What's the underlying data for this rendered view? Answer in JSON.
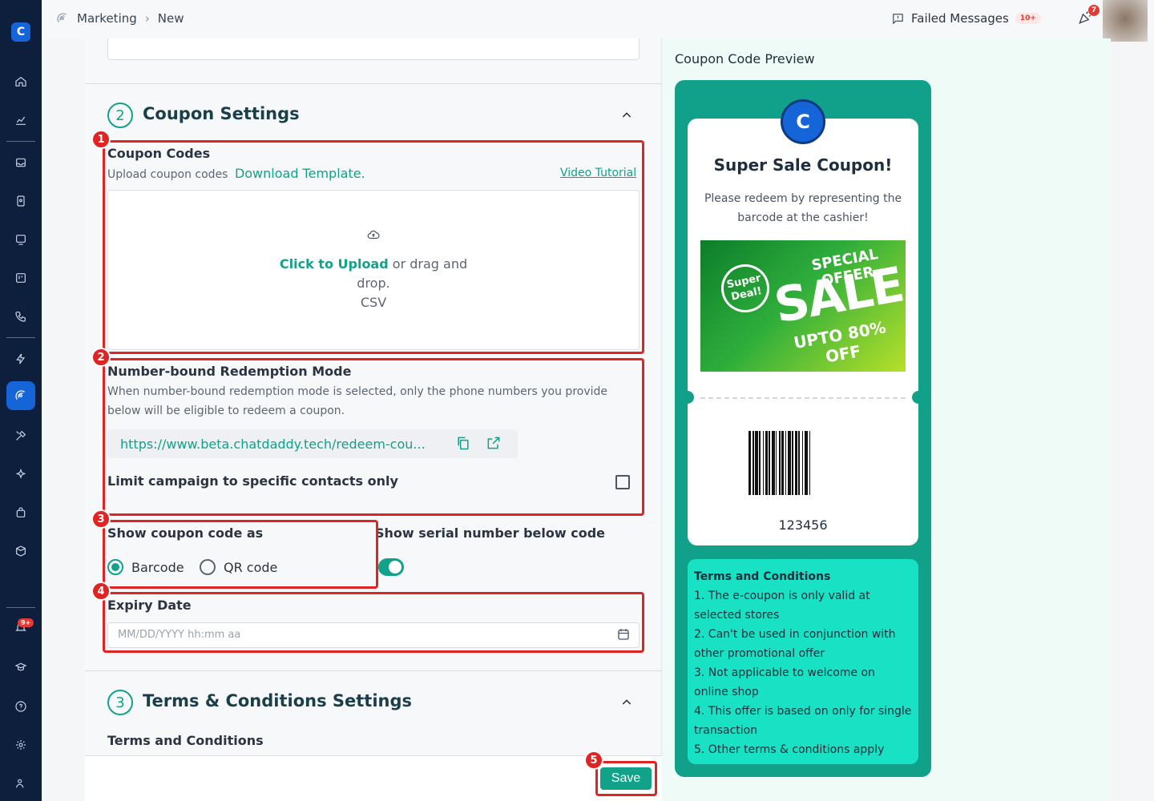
{
  "breadcrumb": {
    "section": "Marketing",
    "current": "New"
  },
  "topbar": {
    "failed_label": "Failed Messages",
    "failed_count": "10+",
    "notif_count": "7"
  },
  "sidebar": {
    "alerts_badge": "9+"
  },
  "coupon_settings": {
    "number": "2",
    "title": "Coupon Settings",
    "codes_label": "Coupon Codes",
    "codes_sub": "Upload coupon codes",
    "download_template": "Download Template.",
    "video_tutorial": "Video Tutorial",
    "upload_cta": "Click to Upload",
    "upload_rest": " or drag and",
    "upload_rest2": "drop.",
    "upload_format": "CSV",
    "redemption_label": "Number-bound Redemption Mode",
    "redemption_desc1": "When number-bound redemption mode is selected, only the phone numbers you provide",
    "redemption_desc2": "below will be eligible to redeem a coupon.",
    "redeem_url": "https://www.beta.chatdaddy.tech/redeem-cou...",
    "limit_label": "Limit campaign to specific contacts only",
    "show_as_label": "Show coupon code as",
    "option_barcode": "Barcode",
    "option_qr": "QR code",
    "serial_label": "Show serial number below code",
    "expiry_label": "Expiry Date",
    "expiry_placeholder": "MM/DD/YYYY hh:mm aa"
  },
  "terms_settings": {
    "number": "3",
    "title": "Terms & Conditions Settings",
    "sub_label": "Terms and Conditions"
  },
  "footer": {
    "save": "Save"
  },
  "annotations": {
    "n1": "1",
    "n2": "2",
    "n3": "3",
    "n4": "4",
    "n5": "5"
  },
  "preview": {
    "heading": "Coupon Code Preview",
    "title": "Super Sale Coupon!",
    "desc": "Please redeem by representing the barcode at the cashier!",
    "banner_special": "SPECIAL OFFER",
    "banner_sale": "SALE",
    "banner_upto": "UPTO 80% OFF",
    "banner_deal1": "Super",
    "banner_deal2": "Deal!",
    "code": "123456",
    "terms_heading": "Terms and Conditions",
    "terms": [
      "1. The e-coupon is only valid at",
      "selected stores",
      "2. Can't be used in conjunction with",
      "other promotional offer",
      "3. Not applicable to welcome on",
      "online shop",
      "4. This offer is based on  only for single",
      "transaction",
      "5. Other terms & conditions apply"
    ]
  },
  "colors": {
    "accent": "#12a189",
    "annotation": "#e02424",
    "sidebar": "#0e1f3d"
  }
}
